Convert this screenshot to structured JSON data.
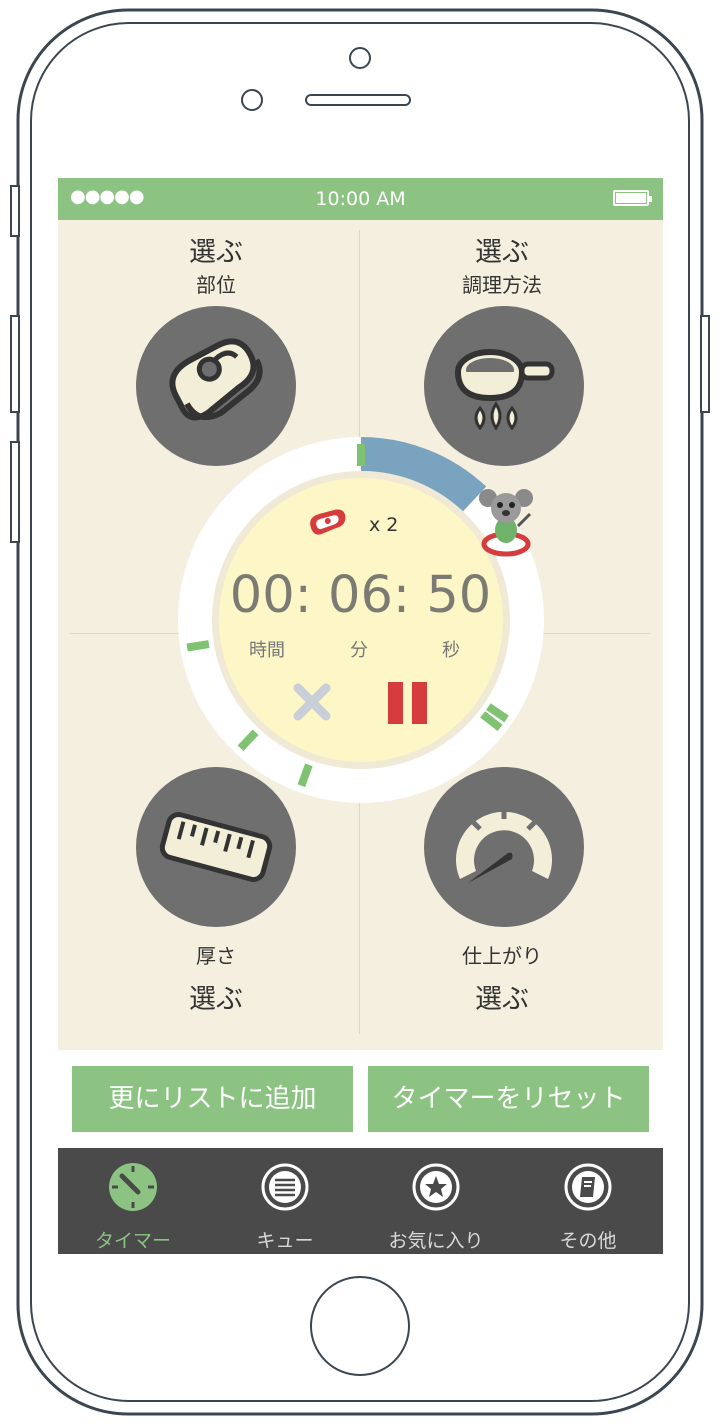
{
  "status_bar": {
    "signal": "●●●●●",
    "time": "10:00 AM"
  },
  "quadrants": {
    "cut": {
      "action": "選ぶ",
      "label": "部位"
    },
    "method": {
      "action": "選ぶ",
      "label": "調理方法"
    },
    "thickness": {
      "action": "選ぶ",
      "label": "厚さ"
    },
    "doneness": {
      "action": "選ぶ",
      "label": "仕上がり"
    }
  },
  "timer": {
    "quantity": "x 2",
    "display": "00: 06: 50",
    "unit_hours": "時間",
    "unit_minutes": "分",
    "unit_seconds": "秒",
    "progress": 0.12
  },
  "actions": {
    "add_to_list": "更にリストに追加",
    "reset_timer": "タイマーをリセット"
  },
  "tabs": [
    {
      "label": "タイマー",
      "icon": "timer-icon",
      "active": true
    },
    {
      "label": "キュー",
      "icon": "list-icon",
      "active": false
    },
    {
      "label": "お気に入り",
      "icon": "star-icon",
      "active": false
    },
    {
      "label": "その他",
      "icon": "book-icon",
      "active": false
    }
  ],
  "colors": {
    "accent": "#8cc383",
    "progress": "#7aa3c0",
    "pause": "#d63c3c",
    "background": "#f4efdf",
    "tabbar": "#4a4a4a"
  }
}
